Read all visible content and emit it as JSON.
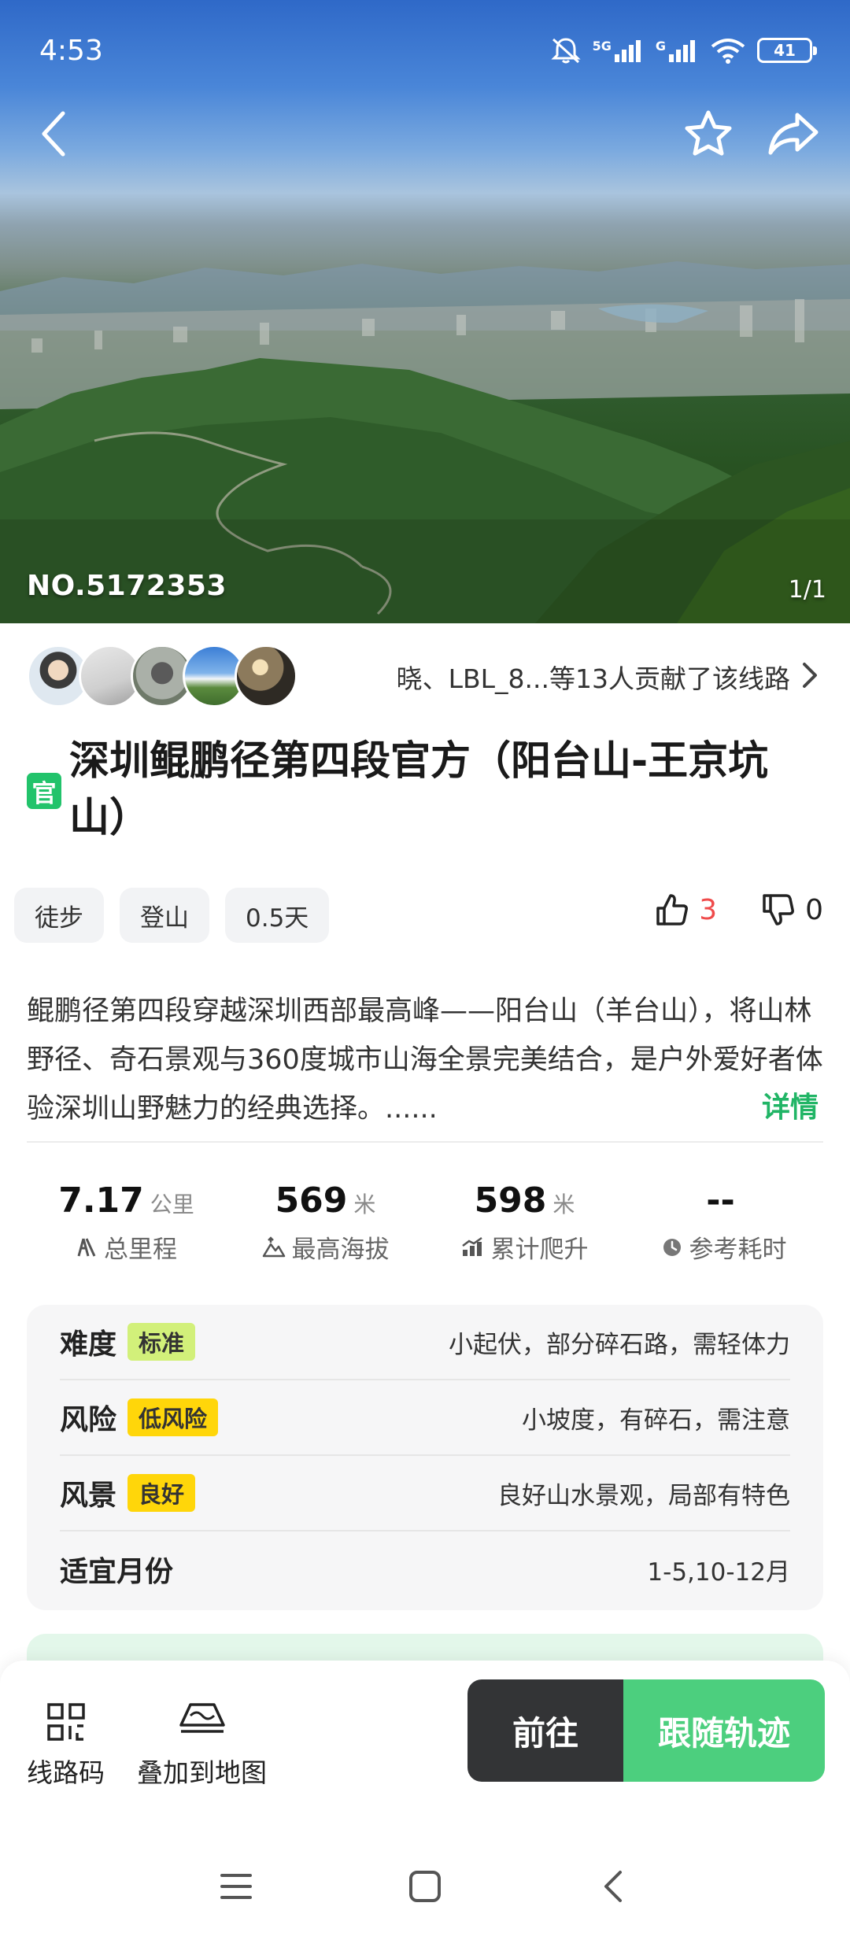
{
  "status_bar": {
    "time": "4:53",
    "battery": "41",
    "signal_1": "5G",
    "signal_2": "G"
  },
  "hero": {
    "route_no": "NO.5172353",
    "photo_count": "1/1"
  },
  "contributors": {
    "text": "晓、LBL_8...等13人贡献了该线路"
  },
  "title": {
    "badge": "官",
    "text": "深圳鲲鹏径第四段官方（阳台山-王京坑山）"
  },
  "tags": [
    "徒步",
    "登山",
    "0.5天"
  ],
  "votes": {
    "up": "3",
    "down": "0"
  },
  "description": {
    "text": "鲲鹏径第四段穿越深圳西部最高峰——阳台山（羊台山），将山林野径、奇石景观与360度城市山海全景完美结合，是户外爱好者体验深圳山野魅力的经典选择。......",
    "more_label": "详情"
  },
  "stats": [
    {
      "value": "7.17",
      "unit": "公里",
      "label": "总里程",
      "icon": "distance-icon"
    },
    {
      "value": "569",
      "unit": "米",
      "label": "最高海拔",
      "icon": "altitude-icon"
    },
    {
      "value": "598",
      "unit": "米",
      "label": "累计爬升",
      "icon": "ascent-icon"
    },
    {
      "value": "--",
      "unit": "",
      "label": "参考耗时",
      "icon": "clock-icon"
    }
  ],
  "ratings": [
    {
      "label": "难度",
      "badge": "标准",
      "badge_color": "#d2f07a",
      "value": "小起伏，部分碎石路，需轻体力"
    },
    {
      "label": "风险",
      "badge": "低风险",
      "badge_color": "#ffd60a",
      "value": "小坡度，有碎石，需注意"
    },
    {
      "label": "风景",
      "badge": "良好",
      "badge_color": "#ffd60a",
      "value": "良好山水景观，局部有特色"
    },
    {
      "label": "适宜月份",
      "badge": "",
      "badge_color": "",
      "value": "1-5,10-12月"
    }
  ],
  "bottom_bar": {
    "route_code_label": "线路码",
    "overlay_map_label": "叠加到地图",
    "go_label": "前往",
    "follow_label": "跟随轨迹"
  },
  "colors": {
    "accent_green": "#4ccf7e",
    "badge_green": "#22c36b",
    "vote_red": "#ef4b4b",
    "dark_button": "#333436"
  }
}
